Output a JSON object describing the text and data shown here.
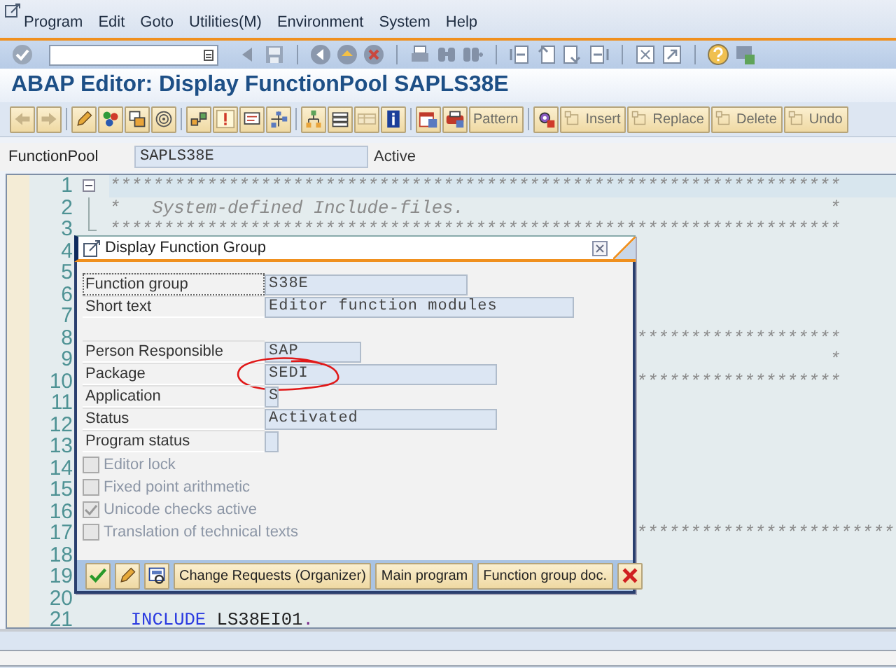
{
  "menu": [
    "Program",
    "Edit",
    "Goto",
    "Utilities(M)",
    "Environment",
    "System",
    "Help"
  ],
  "title": "ABAP Editor: Display FunctionPool SAPLS38E",
  "app_toolbar": [
    {
      "label": "Pattern",
      "disabled": true
    },
    {
      "label": "Insert",
      "disabled": true
    },
    {
      "label": "Replace",
      "disabled": true
    },
    {
      "label": "Delete",
      "disabled": true
    },
    {
      "label": "Undo",
      "disabled": true
    }
  ],
  "header": {
    "label": "FunctionPool",
    "value": "SAPLS38E",
    "status": "Active"
  },
  "editor": {
    "lines": [
      {
        "number": "1",
        "kind": "fold_start",
        "highlighted": true,
        "covered": false,
        "tokens": [
          {
            "kind": "comment",
            "text": "********************************************************************"
          }
        ]
      },
      {
        "number": "2",
        "kind": "fold_inside",
        "highlighted": false,
        "covered": false,
        "tokens": [
          {
            "kind": "comment",
            "text": "*   System-defined Include-files.                                  *"
          }
        ]
      },
      {
        "number": "3",
        "kind": "fold_end",
        "highlighted": false,
        "covered": false,
        "tokens": [
          {
            "kind": "comment",
            "text": "********************************************************************"
          }
        ]
      },
      {
        "number": "4",
        "kind": "plain",
        "highlighted": false
      },
      {
        "number": "5",
        "kind": "plain",
        "highlighted": false
      },
      {
        "number": "6",
        "kind": "plain",
        "highlighted": false
      },
      {
        "number": "7",
        "kind": "plain",
        "highlighted": false
      },
      {
        "number": "8",
        "kind": "plain",
        "highlighted": false,
        "covered": true,
        "tokens": [
          {
            "kind": "comment",
            "text": "*******************"
          }
        ]
      },
      {
        "number": "9",
        "kind": "plain",
        "highlighted": false,
        "covered": true,
        "tokens": [
          {
            "kind": "comment",
            "text": "                  *"
          }
        ]
      },
      {
        "number": "10",
        "kind": "plain",
        "highlighted": false,
        "covered": true,
        "tokens": [
          {
            "kind": "comment",
            "text": "*******************"
          }
        ]
      },
      {
        "number": "11",
        "kind": "plain",
        "highlighted": false
      },
      {
        "number": "12",
        "kind": "plain",
        "highlighted": false
      },
      {
        "number": "13",
        "kind": "plain",
        "highlighted": false
      },
      {
        "number": "14",
        "kind": "plain",
        "highlighted": false
      },
      {
        "number": "15",
        "kind": "plain",
        "highlighted": false
      },
      {
        "number": "16",
        "kind": "plain",
        "highlighted": false
      },
      {
        "number": "17",
        "kind": "plain",
        "highlighted": false,
        "covered": true,
        "tokens": [
          {
            "kind": "comment",
            "text": "************************"
          }
        ]
      },
      {
        "number": "18",
        "kind": "plain",
        "highlighted": false
      },
      {
        "number": "19",
        "kind": "plain",
        "highlighted": false
      },
      {
        "number": "20",
        "kind": "plain",
        "highlighted": false
      },
      {
        "number": "21",
        "kind": "plain",
        "highlighted": false,
        "covered": false,
        "tokens": [
          {
            "kind": "keyword",
            "text": "INCLUDE"
          },
          {
            "kind": "plain",
            "text": "LS38EI01"
          },
          {
            "kind": "punct",
            "text": "."
          }
        ]
      }
    ]
  },
  "dialog": {
    "title": "Display Function Group",
    "field_groups": [
      {
        "fields": [
          {
            "label": "Function group",
            "value": "S38E",
            "focused": true,
            "circled": false
          },
          {
            "label": "Short text",
            "value": "Editor function modules",
            "focused": false,
            "circled": false
          }
        ]
      },
      {
        "fields": [
          {
            "label": "Person Responsible",
            "value": "SAP",
            "focused": false,
            "circled": false
          },
          {
            "label": "Package",
            "value": "SEDI",
            "focused": false,
            "circled": true
          },
          {
            "label": "Application",
            "value": "S",
            "focused": false,
            "circled": false
          },
          {
            "label": "Status",
            "value": "Activated",
            "focused": false,
            "circled": false
          },
          {
            "label": "Program status",
            "focused": false,
            "circled": false
          }
        ]
      }
    ],
    "checkboxes": [
      {
        "label": "Editor lock",
        "checked": false,
        "disabled": true
      },
      {
        "label": "Fixed point arithmetic",
        "checked": false,
        "disabled": true
      },
      {
        "label": "Unicode checks active",
        "checked": true,
        "disabled": true
      },
      {
        "label": "Translation of technical texts",
        "checked": false,
        "disabled": true
      }
    ],
    "buttons": [
      "Change Requests (Organizer)",
      "Main program",
      "Function group doc."
    ]
  }
}
